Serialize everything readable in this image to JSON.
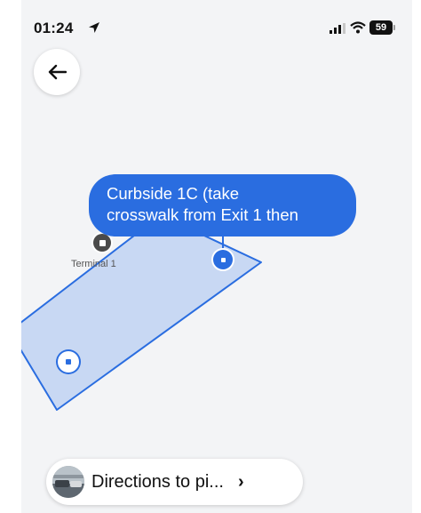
{
  "status_bar": {
    "time": "01:24",
    "battery_level": "59",
    "icons": [
      "location-arrow-icon",
      "signal-icon",
      "wifi-icon",
      "battery-icon"
    ]
  },
  "map": {
    "pickup_tooltip": {
      "line1": "Curbside 1C (take",
      "line2": "crosswalk from Exit 1 then"
    },
    "terminal_label": "Terminal 1",
    "colors": {
      "accent": "#2a6de0",
      "zone_fill": "#c8d8f3",
      "map_background": "#f3f4f6"
    }
  },
  "directions_button": {
    "label": "Directions to pi...",
    "chevron": "›"
  },
  "back_button": {
    "icon": "arrow-left-icon"
  }
}
